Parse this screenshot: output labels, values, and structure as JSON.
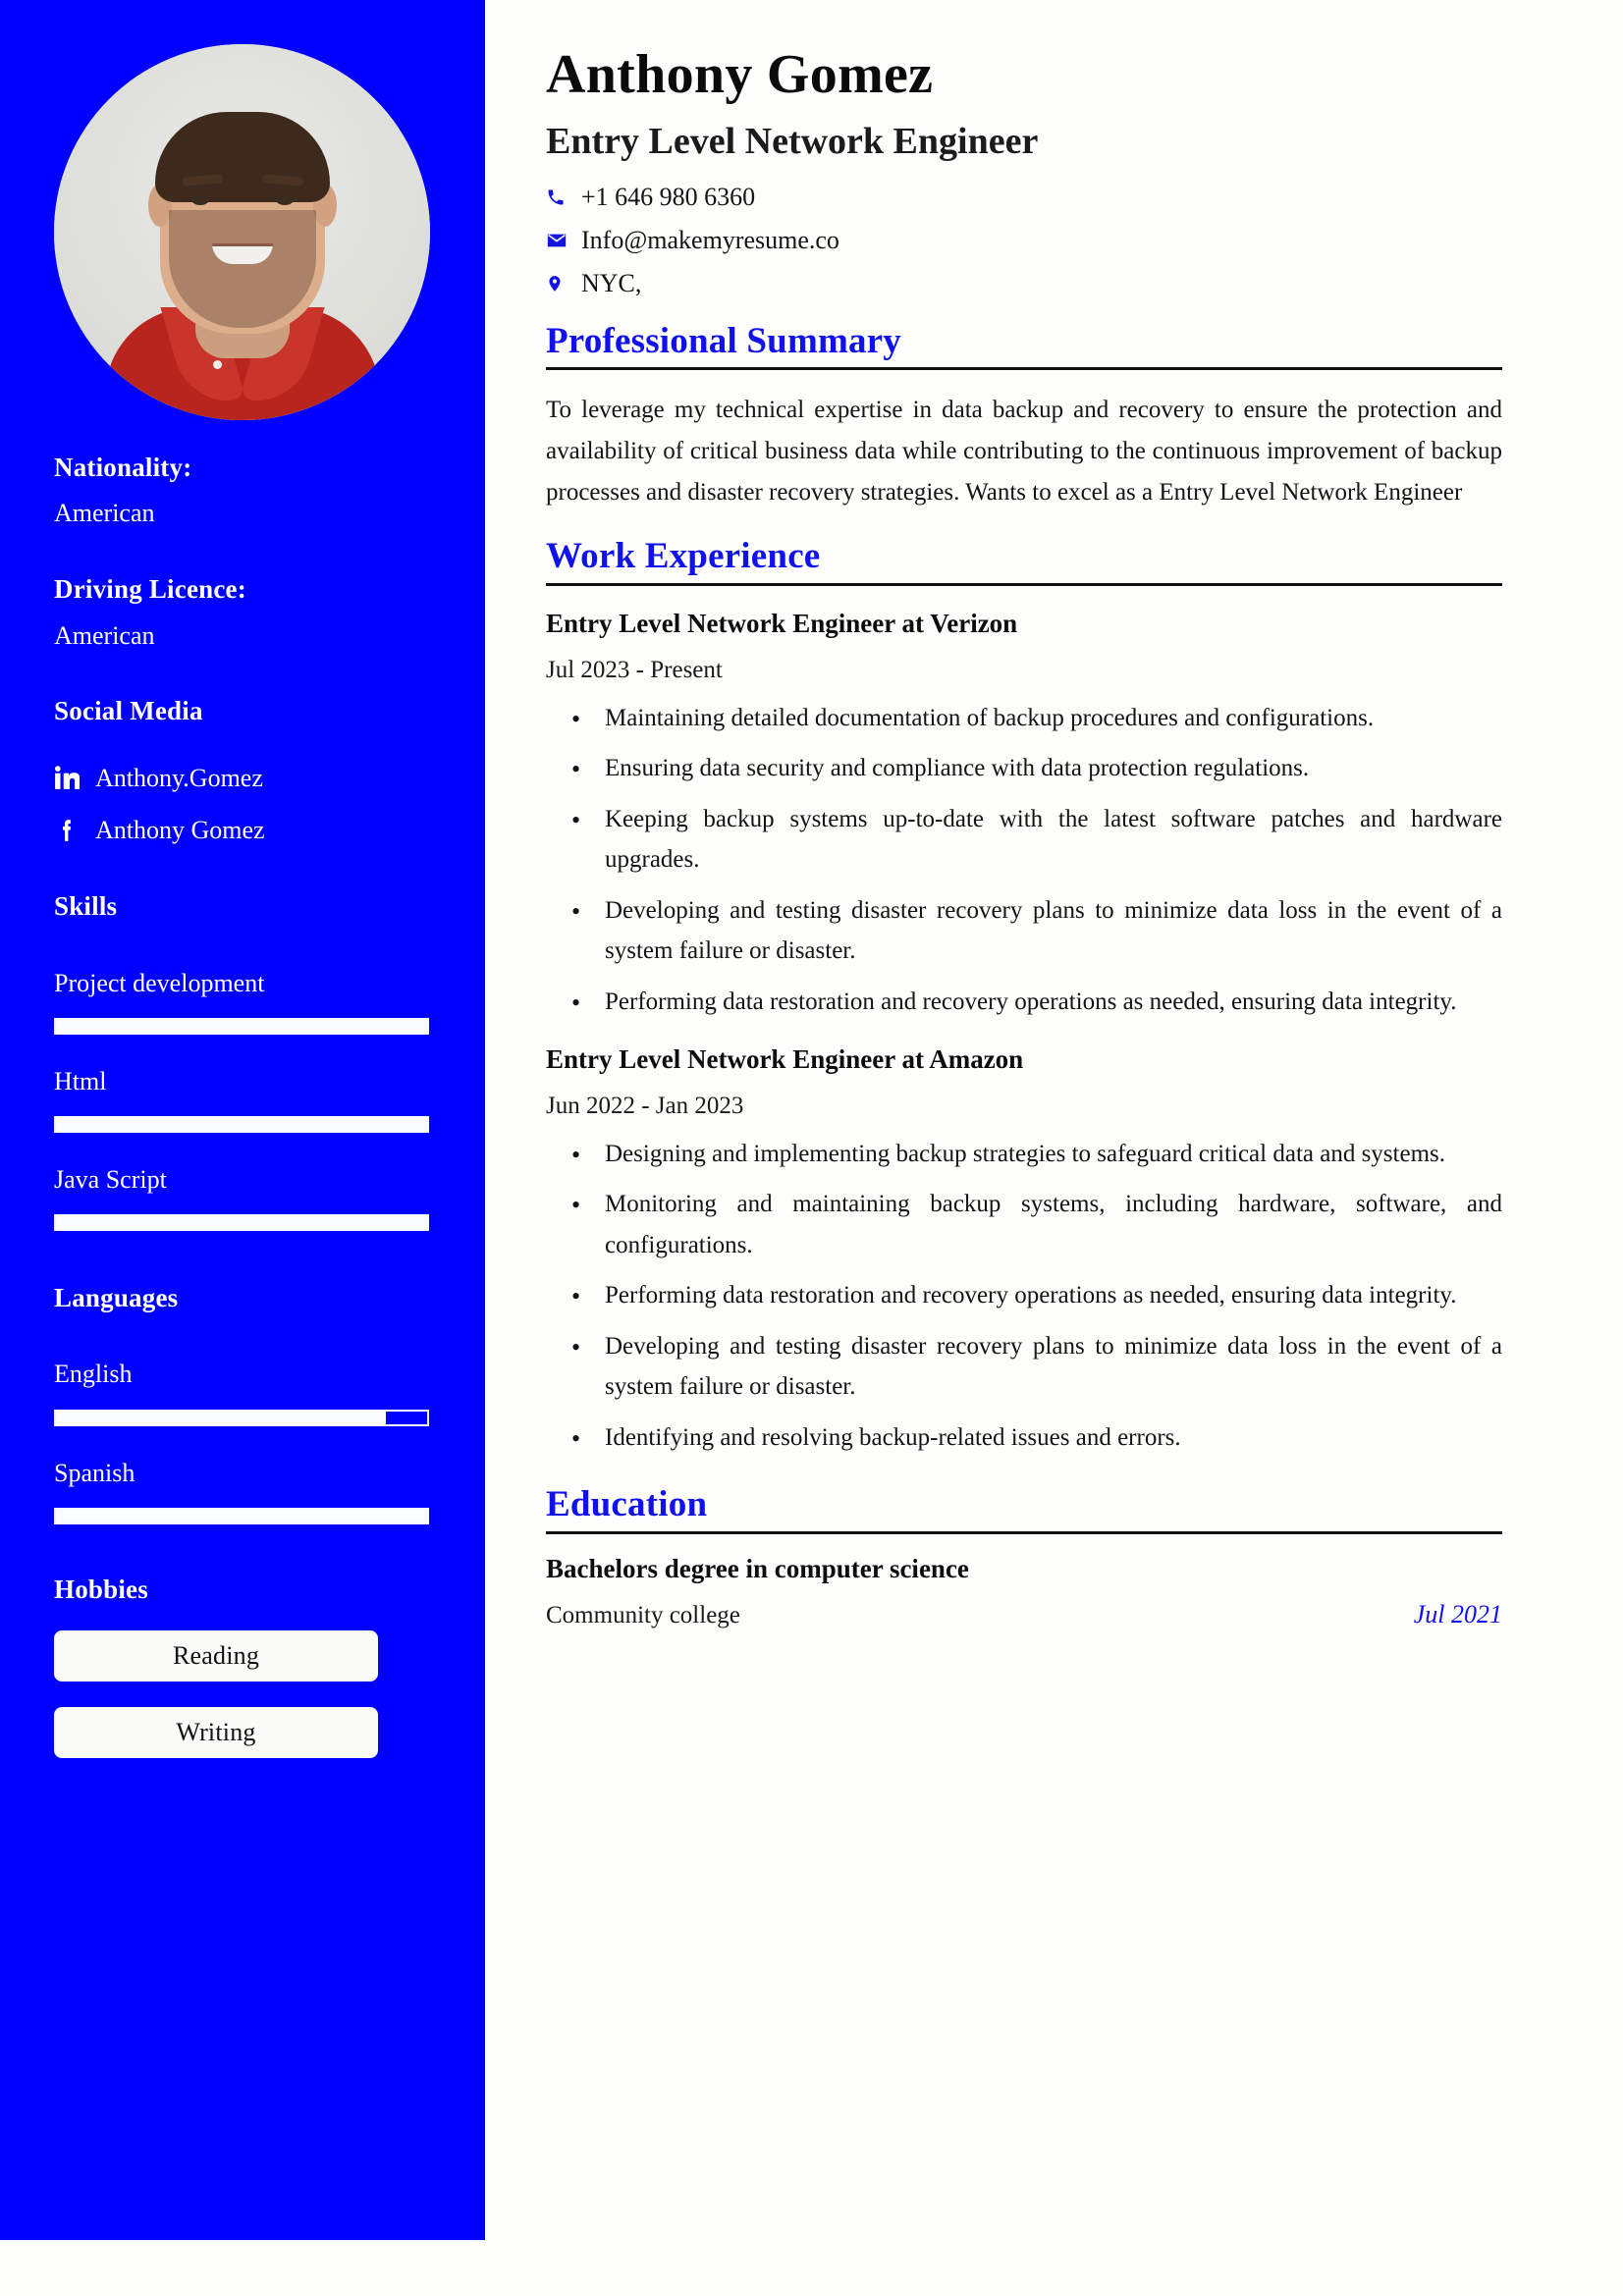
{
  "theme": {
    "sidebar_bg": "#0000FF",
    "page_bg": "#FDFDFB",
    "accent": "#1111EE",
    "text": "#141414"
  },
  "sidebar": {
    "avatar_alt": "portrait-photo",
    "nationality": {
      "label": "Nationality:",
      "value": "American"
    },
    "driving_licence": {
      "label": "Driving Licence:",
      "value": "American"
    },
    "social_media": {
      "label": "Social Media",
      "items": [
        {
          "icon": "linkedin-icon",
          "text": "Anthony.Gomez"
        },
        {
          "icon": "facebook-icon",
          "text": "Anthony Gomez"
        }
      ]
    },
    "skills": {
      "label": "Skills",
      "items": [
        {
          "name": "Project development",
          "level": 100
        },
        {
          "name": "Html",
          "level": 100
        },
        {
          "name": "Java Script",
          "level": 100
        }
      ]
    },
    "languages": {
      "label": "Languages",
      "items": [
        {
          "name": "English",
          "level": 89
        },
        {
          "name": "Spanish",
          "level": 100
        }
      ]
    },
    "hobbies": {
      "label": "Hobbies",
      "items": [
        {
          "name": "Reading"
        },
        {
          "name": "Writing"
        }
      ]
    }
  },
  "header": {
    "name": "Anthony Gomez",
    "job_title": "Entry Level Network Engineer",
    "contacts": [
      {
        "icon": "phone-icon",
        "value": "+1 646 980 6360"
      },
      {
        "icon": "email-icon",
        "value": "Info@makemyresume.co"
      },
      {
        "icon": "location-pin-icon",
        "value": "NYC,"
      }
    ]
  },
  "sections": {
    "summary": {
      "heading": "Professional Summary",
      "body": "To leverage my technical expertise in data backup and recovery to ensure the protection and availability of critical business data while contributing to the continuous improvement of backup processes and disaster recovery strategies. Wants to excel as a Entry Level Network Engineer"
    },
    "work": {
      "heading": "Work Experience",
      "jobs": [
        {
          "title": "Entry Level Network Engineer at Verizon",
          "date": "Jul 2023 - Present",
          "bullets": [
            "Maintaining detailed documentation of backup procedures and configurations.",
            "Ensuring data security and compliance with data protection regulations.",
            "Keeping backup systems up-to-date with the latest software patches and hardware upgrades.",
            "Developing and testing disaster recovery plans to minimize data loss in the event of a system failure or disaster.",
            "Performing data restoration and recovery operations as needed, ensuring data integrity."
          ]
        },
        {
          "title": "Entry Level Network Engineer at Amazon",
          "date": "Jun 2022 - Jan 2023",
          "bullets": [
            "Designing and implementing backup strategies to safeguard critical data and systems.",
            "Monitoring and maintaining backup systems, including hardware, software, and configurations.",
            "Performing data restoration and recovery operations as needed, ensuring data integrity.",
            " Developing and testing disaster recovery plans to minimize data loss in the event of a system failure or disaster.",
            "Identifying and resolving backup-related issues and errors."
          ]
        }
      ]
    },
    "education": {
      "heading": "Education",
      "entries": [
        {
          "degree": "Bachelors degree in computer science",
          "school": "Community college",
          "date": "Jul 2021"
        }
      ]
    }
  }
}
